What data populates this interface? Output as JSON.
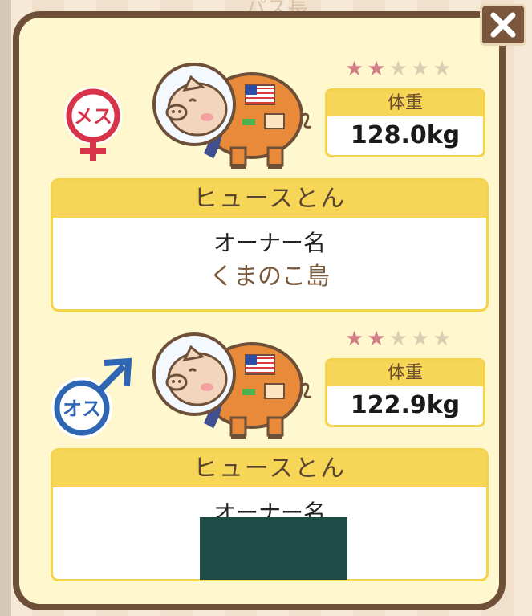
{
  "background": {
    "peek_text": "パス長"
  },
  "close_button": {
    "label": "✕",
    "icon": "close-icon"
  },
  "pigs": [
    {
      "gender": "female",
      "gender_label": "メス",
      "gender_color": "#d7344a",
      "stars_filled": 2,
      "stars_total": 5,
      "weight_label": "体重",
      "weight_value": "128.0kg",
      "name": "ヒュースとん",
      "owner_label": "オーナー名",
      "owner_value": "くまのこ島"
    },
    {
      "gender": "male",
      "gender_label": "オス",
      "gender_color": "#2e66b3",
      "stars_filled": 2,
      "stars_total": 5,
      "weight_label": "体重",
      "weight_value": "122.9kg",
      "name": "ヒュースとん",
      "owner_label": "オーナー名",
      "owner_value": ""
    }
  ],
  "colors": {
    "frame": "#6e4f38",
    "panel": "#fff8cf",
    "header_yellow": "#f7d657",
    "star_on": "#d27e86",
    "star_off": "#d8cfb2",
    "redaction": "#1f4b47"
  }
}
